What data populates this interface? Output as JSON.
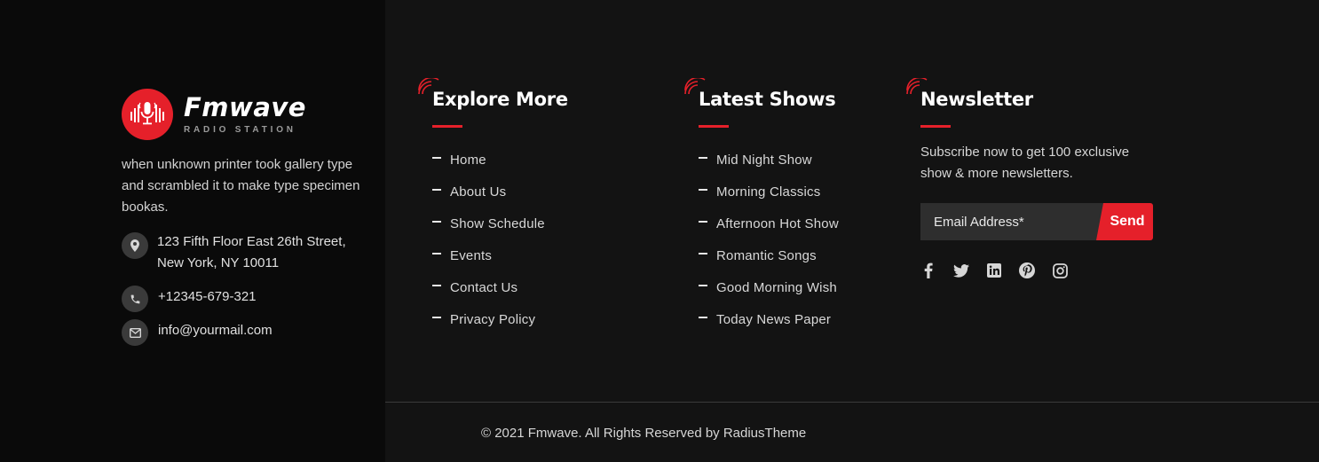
{
  "brand": {
    "name": "Fmwave",
    "tagline": "RADIO STATION",
    "colors": {
      "accent": "#e5202a",
      "background": "#131313",
      "left_panel": "#0a0a0a"
    }
  },
  "about": {
    "text": "when unknown printer took gallery type and scrambled it to make type specimen bookas."
  },
  "contact": {
    "address_line1": "123 Fifth Floor East 26th Street,",
    "address_line2": "New York, NY 10011",
    "phone": "+12345-679-321",
    "email": "info@yourmail.com",
    "icons": [
      "location-pin-icon",
      "phone-icon",
      "envelope-icon"
    ]
  },
  "explore": {
    "title": "Explore More",
    "items": [
      "Home",
      "About Us",
      "Show Schedule",
      "Events",
      "Contact Us",
      "Privacy Policy"
    ]
  },
  "shows": {
    "title": "Latest Shows",
    "items": [
      "Mid Night Show",
      "Morning Classics",
      "Afternoon Hot Show",
      "Romantic Songs",
      "Good Morning Wish",
      "Today News Paper"
    ]
  },
  "newsletter": {
    "title": "Newsletter",
    "text": "Subscribe now to get 100 exclusive show & more newsletters.",
    "input_placeholder": "Email Address*",
    "send_label": "Send",
    "social": [
      "facebook-icon",
      "twitter-icon",
      "linkedin-icon",
      "pinterest-icon",
      "instagram-icon"
    ]
  },
  "footer": {
    "copyright": "© 2021 Fmwave. All Rights Reserved by RadiusTheme"
  }
}
